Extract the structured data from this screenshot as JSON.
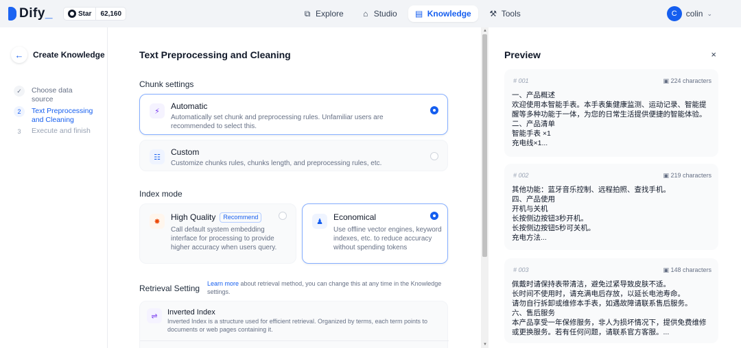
{
  "topbar": {
    "brand": "Dify",
    "star_label": "Star",
    "star_count": "62,160",
    "nav": [
      {
        "label": "Explore",
        "icon": "compass-icon"
      },
      {
        "label": "Studio",
        "icon": "robot-icon"
      },
      {
        "label": "Knowledge",
        "icon": "book-icon",
        "active": true
      },
      {
        "label": "Tools",
        "icon": "tools-icon"
      }
    ],
    "user": {
      "initial": "C",
      "name": "colin"
    }
  },
  "steps": {
    "title": "Create Knowledge",
    "items": [
      {
        "num": "✓",
        "label": "Choose data source",
        "state": "done"
      },
      {
        "num": "2",
        "label": "Text Preprocessing and Cleaning",
        "state": "active"
      },
      {
        "num": "3",
        "label": "Execute and finish",
        "state": "todo"
      }
    ]
  },
  "main": {
    "title": "Text Preprocessing and Cleaning",
    "chunk_settings_label": "Chunk settings",
    "automatic": {
      "title": "Automatic",
      "desc": "Automatically set chunk and preprocessing rules. Unfamiliar users are recommended to select this."
    },
    "custom": {
      "title": "Custom",
      "desc": "Customize chunks rules, chunks length, and preprocessing rules, etc."
    },
    "index_mode_label": "Index mode",
    "high_quality": {
      "title": "High Quality",
      "badge": "Recommend",
      "desc": "Call default system embedding interface for processing to provide higher accuracy when users query."
    },
    "economical": {
      "title": "Economical",
      "desc": "Use offline vector engines, keyword indexes, etc. to reduce accuracy without spending tokens"
    },
    "retrieval_label": "Retrieval Setting",
    "retrieval_link": "Learn more",
    "retrieval_note": " about retrieval method, you can change this at any time in the Knowledge settings.",
    "inverted_index": {
      "title": "Inverted Index",
      "desc": "Inverted Index is a structure used for efficient retrieval. Organized by terms, each term points to documents or web pages containing it."
    }
  },
  "preview": {
    "title": "Preview",
    "close": "×",
    "chunks": [
      {
        "id": "# 001",
        "chars": "224 characters",
        "text": "一、产品概述\n欢迎使用本智能手表。本手表集健康监测、运动记录、智能提醒等多种功能于一体，为您的日常生活提供便捷的智能体验。\n二、产品清单\n智能手表 ×1\n充电线×1..."
      },
      {
        "id": "# 002",
        "chars": "219 characters",
        "text": "其他功能：蓝牙音乐控制、远程拍照、查找手机。\n四、产品使用\n开机与关机\n长按侧边按钮3秒开机。\n长按侧边按钮5秒可关机。\n充电方法..."
      },
      {
        "id": "# 003",
        "chars": "148 characters",
        "text": "佩戴时请保持表带清洁，避免过紧导致皮肤不适。\n长时间不使用时，请充满电后存放，以延长电池寿命。\n请勿自行拆卸或维修本手表，如遇故障请联系售后服务。\n六、售后服务\n本产品享受一年保修服务，非人为损坏情况下，提供免费维修或更换服务。若有任何问题，请联系官方客服。..."
      }
    ]
  },
  "colors": {
    "accent": "#155eef",
    "selected_border": "#84adff",
    "card_bg": "#f9fafb"
  }
}
